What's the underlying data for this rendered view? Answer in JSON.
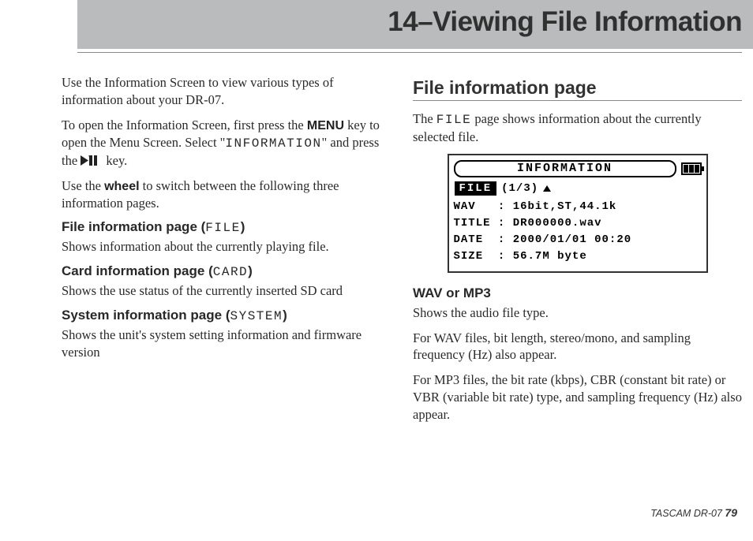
{
  "header": {
    "title": "14–Viewing File Information"
  },
  "left": {
    "p1": "Use the Information Screen to view various types of information about your DR-07.",
    "p2a": "To open the Information Screen, first press the ",
    "p2_menu": "MENU",
    "p2b": " key to open the Menu Screen. Select \"",
    "p2_info": "INFORMATION",
    "p2c": "\" and press the ",
    "p2d": " key.",
    "p3a": "Use the ",
    "p3_wheel": "wheel",
    "p3b": " to switch between the following three information pages.",
    "h1a": "File information page (",
    "h1_mono": "FILE",
    "h1b": ")",
    "d1": "Shows information about the currently playing file.",
    "h2a": "Card information page (",
    "h2_mono": "CARD",
    "h2b": ")",
    "d2": "Shows the use status of the currently inserted SD card",
    "h3a": "System information page (",
    "h3_mono": "SYSTEM",
    "h3b": ")",
    "d3": "Shows the unit's system setting information and firmware version"
  },
  "right": {
    "section_title": "File information page",
    "p1a": "The ",
    "p1_mono": "FILE",
    "p1b": " page shows information about the currently selected file.",
    "lcd": {
      "top": "INFORMATION",
      "tab_label": "FILE",
      "tab_count": "(1/3)",
      "lines": {
        "l1": "WAV   : 16bit,ST,44.1k",
        "l2": "TITLE : DR000000.wav",
        "l3": "DATE  : 2000/01/01 00:20",
        "l4": "SIZE  : 56.7M byte"
      }
    },
    "h_wav": "WAV or MP3",
    "p2": "Shows the audio file type.",
    "p3": "For WAV files, bit length, stereo/mono, and sampling frequency (Hz) also appear.",
    "p4": "For MP3 files, the bit rate (kbps), CBR (constant bit rate) or VBR (variable bit rate) type, and sampling frequency (Hz) also appear."
  },
  "footer": {
    "product": "TASCAM  DR-07 ",
    "page_no": "79"
  }
}
